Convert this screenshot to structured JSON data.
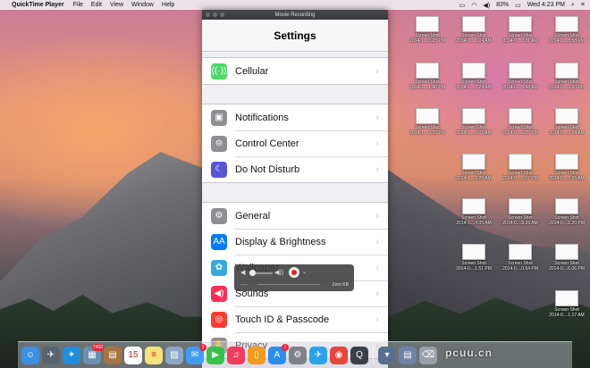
{
  "menubar": {
    "app_name": "QuickTime Player",
    "menus": [
      "File",
      "Edit",
      "View",
      "Window",
      "Help"
    ],
    "battery": "83%",
    "clock": "Wed 4:23 PM"
  },
  "window": {
    "title": "Movie Recording"
  },
  "settings": {
    "title": "Settings",
    "groups": [
      [
        {
          "label": "Cellular",
          "icon": "cellular-icon",
          "color": "#4cd964",
          "glyph": "((·))"
        }
      ],
      [
        {
          "label": "Notifications",
          "icon": "notifications-icon",
          "color": "#8e8e93",
          "glyph": "▣"
        },
        {
          "label": "Control Center",
          "icon": "control-center-icon",
          "color": "#8e8e93",
          "glyph": "⊜"
        },
        {
          "label": "Do Not Disturb",
          "icon": "moon-icon",
          "color": "#5856d6",
          "glyph": "☾"
        }
      ],
      [
        {
          "label": "General",
          "icon": "gear-icon",
          "color": "#8e8e93",
          "glyph": "⚙"
        },
        {
          "label": "Display & Brightness",
          "icon": "display-icon",
          "color": "#007aff",
          "glyph": "AA"
        },
        {
          "label": "Wallpaper",
          "icon": "wallpaper-icon",
          "color": "#34aadc",
          "glyph": "✿"
        },
        {
          "label": "Sounds",
          "icon": "sounds-icon",
          "color": "#ff2d55",
          "glyph": "◀)"
        },
        {
          "label": "Touch ID & Passcode",
          "icon": "fingerprint-icon",
          "color": "#ff3b30",
          "glyph": "◎"
        },
        {
          "label": "Privacy",
          "icon": "hand-icon",
          "color": "#8e8e93",
          "glyph": "✋"
        }
      ]
    ]
  },
  "recording_hud": {
    "time": "--:--",
    "size": "Zero KB"
  },
  "desktop_icons": [
    {
      "line1": "",
      "line2": ""
    },
    {
      "line1": "Screen Shot",
      "line2": "2014-1....0.23 PM"
    },
    {
      "line1": "Screen Shot",
      "line2": "2014-1....1.24 AM"
    },
    {
      "line1": "Screen Shot",
      "line2": "2014-0....7.11 AM"
    },
    {
      "line1": "Screen Shot",
      "line2": "2014-0....8.58 PM"
    },
    {
      "line1": "Screen Shot",
      "line2": "2014-1....1.40 PM"
    },
    {
      "line1": "Screen Shot",
      "line2": "2014-1....7.24 AM"
    },
    {
      "line1": "Screen Shot",
      "line2": "2014-0....5.48 AM"
    },
    {
      "line1": "Screen Shot",
      "line2": "2014-0....9.20 PM"
    },
    {
      "line1": "Screen Shot",
      "line2": "2014-1....3.33 PM"
    },
    {
      "line1": "Screen Shot",
      "line2": "2014-1....0.01 AM"
    },
    {
      "line1": "Screen Shot",
      "line2": "2014-0....6.25 PM"
    },
    {
      "line1": "Screen Shot",
      "line2": "2014-0....3.14 AM"
    },
    {
      "line1": "Screen Shot",
      "line2": "2014-1....2.25 AM"
    },
    {
      "line1": "Screen Shot",
      "line2": "2014-0....6.07 PM"
    },
    {
      "line1": "Screen Shot",
      "line2": "2014-0....8.05 AM"
    },
    {
      "line1": "Screen Shot",
      "line2": "2014-1....4.35 AM"
    },
    {
      "line1": "Screen Shot",
      "line2": "2014-0....8.26 AM"
    },
    {
      "line1": "Screen Shot",
      "line2": "2014-0....1.20 PM"
    },
    {
      "line1": "Screen Shot",
      "line2": "2014-0....1.51 PM"
    },
    {
      "line1": "Screen Shot",
      "line2": "2014-0....0.54 PM"
    },
    {
      "line1": "Screen Shot",
      "line2": "2014-0....6.06 PM"
    },
    {
      "line1": "Screen Shot",
      "line2": "2014-0....1.17 AM"
    }
  ],
  "dock": [
    {
      "name": "finder-icon",
      "color": "#3b8fe4",
      "glyph": "☺",
      "badge": ""
    },
    {
      "name": "launchpad-icon",
      "color": "#5a6470",
      "glyph": "✈",
      "badge": ""
    },
    {
      "name": "safari-icon",
      "color": "#1f8fe0",
      "glyph": "✦",
      "badge": ""
    },
    {
      "name": "photo-icon",
      "color": "#6a8fb0",
      "glyph": "▦",
      "badge": "7460"
    },
    {
      "name": "notebook-icon",
      "color": "#a7743e",
      "glyph": "▤",
      "badge": ""
    },
    {
      "name": "calendar-icon",
      "color": "#ffffff",
      "glyph": "15",
      "badge": ""
    },
    {
      "name": "notes-icon",
      "color": "#f6e27a",
      "glyph": "≡",
      "badge": ""
    },
    {
      "name": "preview-icon",
      "color": "#8aa7c6",
      "glyph": "▨",
      "badge": ""
    },
    {
      "name": "messages-icon",
      "color": "#3e9cf5",
      "glyph": "✉",
      "badge": "3"
    },
    {
      "name": "facetime-icon",
      "color": "#37c24a",
      "glyph": "▶",
      "badge": ""
    },
    {
      "name": "music-icon",
      "color": "#f03e5c",
      "glyph": "♫",
      "badge": ""
    },
    {
      "name": "ibooks-icon",
      "color": "#f29b1d",
      "glyph": "▯",
      "badge": ""
    },
    {
      "name": "app-store-icon",
      "color": "#2a8ef0",
      "glyph": "A",
      "badge": "1"
    },
    {
      "name": "system-preferences-icon",
      "color": "#7f8288",
      "glyph": "⚙",
      "badge": ""
    },
    {
      "name": "twitter-icon",
      "color": "#2aa3ee",
      "glyph": "✈",
      "badge": ""
    },
    {
      "name": "chrome-icon",
      "color": "#e7473b",
      "glyph": "◉",
      "badge": ""
    },
    {
      "name": "quicktime-icon",
      "color": "#3a3f48",
      "glyph": "Q",
      "badge": ""
    },
    {
      "name": "sep",
      "color": "",
      "glyph": "",
      "badge": ""
    },
    {
      "name": "downloads-icon",
      "color": "#5a6f8e",
      "glyph": "▾",
      "badge": ""
    },
    {
      "name": "documents-icon",
      "color": "#6d84a6",
      "glyph": "▤",
      "badge": ""
    },
    {
      "name": "trash-icon",
      "color": "#9aa0a8",
      "glyph": "⌫",
      "badge": ""
    }
  ]
}
